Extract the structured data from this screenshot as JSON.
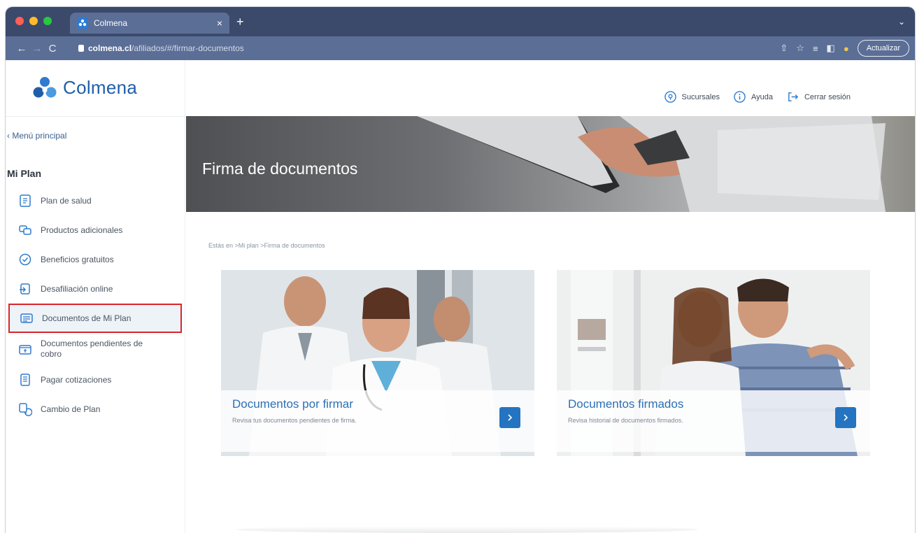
{
  "browser": {
    "tab_title": "Colmena",
    "tab_close": "×",
    "new_tab": "+",
    "url_host": "colmena.cl",
    "url_path": "/afiliados/#/firmar-documentos",
    "update_button": "Actualizar"
  },
  "header": {
    "logo_text": "Colmena",
    "links": {
      "branches": "Sucursales",
      "help": "Ayuda",
      "logout": "Cerrar sesión"
    }
  },
  "sidebar": {
    "back_link": "‹ Menú principal",
    "section_title": "Mi Plan",
    "items": [
      {
        "label": "Plan de salud"
      },
      {
        "label": "Productos adicionales"
      },
      {
        "label": "Beneficios gratuitos"
      },
      {
        "label": "Desafiliación online"
      },
      {
        "label": "Documentos de Mi Plan"
      },
      {
        "label": "Documentos pendientes de cobro"
      },
      {
        "label": "Pagar cotizaciones"
      },
      {
        "label": "Cambio de Plan"
      }
    ],
    "active_index": 4
  },
  "hero": {
    "title": "Firma de documentos"
  },
  "breadcrumb": "Estás en >Mi plan >Firma de documentos",
  "cards": [
    {
      "title": "Documentos por firmar",
      "description": "Revisa tus documentos pendientes de firma."
    },
    {
      "title": "Documentos firmados",
      "description": "Revisa historial de documentos firmados."
    }
  ],
  "colors": {
    "brand_blue": "#1f5fa8",
    "button_blue": "#2474c1",
    "active_outline": "#d9262b",
    "browser_chrome": "#5b6e96"
  }
}
